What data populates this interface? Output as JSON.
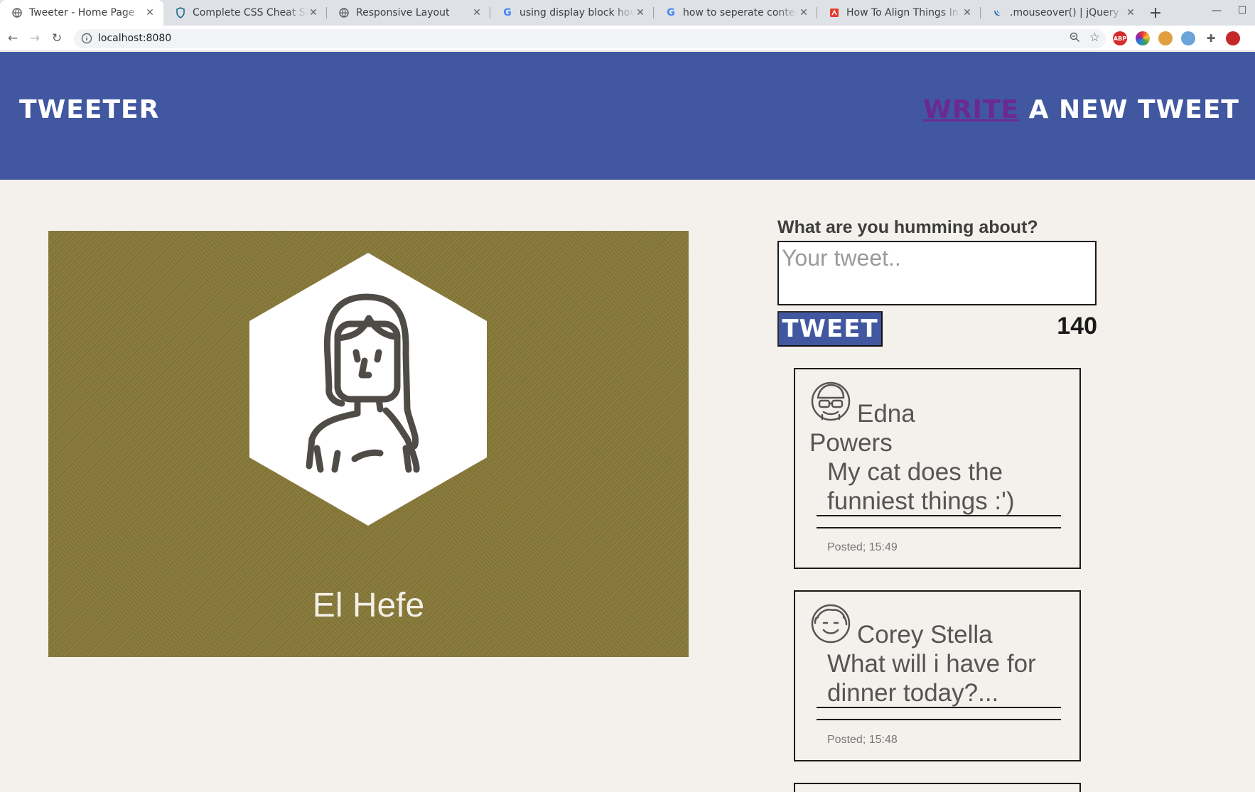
{
  "browser": {
    "tabs": [
      {
        "title": "Tweeter - Home Page",
        "favicon": "globe-icon",
        "active": true
      },
      {
        "title": "Complete CSS Cheat Sheet",
        "favicon": "shield-icon",
        "active": false
      },
      {
        "title": "Responsive Layout",
        "favicon": "globe-icon",
        "active": false
      },
      {
        "title": "using display block how",
        "favicon": "google-icon",
        "active": false
      },
      {
        "title": "how to seperate content",
        "favicon": "google-icon",
        "active": false
      },
      {
        "title": "How To Align Things In CSS",
        "favicon": "smashing-icon",
        "active": false
      },
      {
        "title": ".mouseover() | jQuery API",
        "favicon": "jquery-icon",
        "active": false
      }
    ],
    "url": "localhost:8080",
    "extensions": [
      "ABP",
      "color-picker",
      "cookie",
      "edge",
      "puzzle",
      "spider"
    ]
  },
  "header": {
    "brand": "TWEETER",
    "compose_link": "WRITE",
    "compose_rest": " A NEW TWEET",
    "background": "#4157a0"
  },
  "profile": {
    "name": "El Hefe",
    "avatar": "woman-avatar-icon",
    "background": "#8a7b3a"
  },
  "composer": {
    "label": "What are you humming about?",
    "placeholder": "Your tweet..",
    "button": "TWEET",
    "counter": "140"
  },
  "tweets": [
    {
      "name_line1": "Edna",
      "name_line2": "Powers",
      "text_line1": "My cat does the",
      "text_line2": "funniest things :')",
      "posted": "Posted; 15:49",
      "avatar": "glasses-avatar-icon"
    },
    {
      "name_line1": "Corey Stella",
      "text_line1": "What will i have for",
      "text_line2": "dinner today?...",
      "posted": "Posted; 15:48",
      "avatar": "smile-avatar-icon"
    }
  ]
}
